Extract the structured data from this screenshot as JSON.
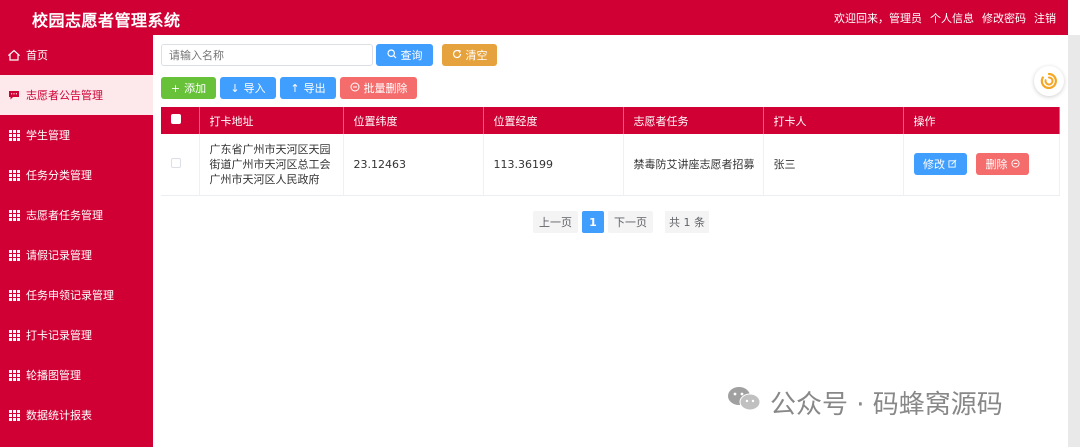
{
  "app": {
    "title": "校园志愿者管理系统"
  },
  "header": {
    "welcome": "欢迎回来，管理员",
    "profile": "个人信息",
    "change_password": "修改密码",
    "logout": "注销"
  },
  "sidebar": {
    "items": [
      {
        "label": "首页",
        "icon": "home-icon"
      },
      {
        "label": "志愿者公告管理",
        "icon": "message-icon"
      },
      {
        "label": "学生管理",
        "icon": "grid-icon"
      },
      {
        "label": "任务分类管理",
        "icon": "grid-icon"
      },
      {
        "label": "志愿者任务管理",
        "icon": "grid-icon"
      },
      {
        "label": "请假记录管理",
        "icon": "grid-icon"
      },
      {
        "label": "任务申领记录管理",
        "icon": "grid-icon"
      },
      {
        "label": "打卡记录管理",
        "icon": "grid-icon"
      },
      {
        "label": "轮播图管理",
        "icon": "grid-icon"
      },
      {
        "label": "数据统计报表",
        "icon": "grid-icon"
      }
    ]
  },
  "search": {
    "placeholder": "请输入名称",
    "query_label": "查询",
    "clear_label": "清空"
  },
  "toolbar": {
    "add_label": "添加",
    "import_label": "导入",
    "export_label": "导出",
    "batch_delete_label": "批量删除"
  },
  "table": {
    "columns": [
      "打卡地址",
      "位置纬度",
      "位置经度",
      "志愿者任务",
      "打卡人",
      "操作"
    ],
    "rows": [
      {
        "address": "广东省广州市天河区天园街道广州市天河区总工会广州市天河区人民政府",
        "lat": "23.12463",
        "lng": "113.36199",
        "task": "禁毒防艾讲座志愿者招募",
        "person": "张三"
      }
    ],
    "edit_label": "修改",
    "delete_label": "删除"
  },
  "pagination": {
    "prev": "上一页",
    "page": "1",
    "next": "下一页",
    "total": "共 1 条"
  },
  "watermark": {
    "text": "公众号 · 码蜂窝源码"
  },
  "colors": {
    "primary": "#d00034",
    "blue": "#409eff",
    "orange": "#e6a23c",
    "green": "#67c23a",
    "red": "#f56c6c"
  }
}
